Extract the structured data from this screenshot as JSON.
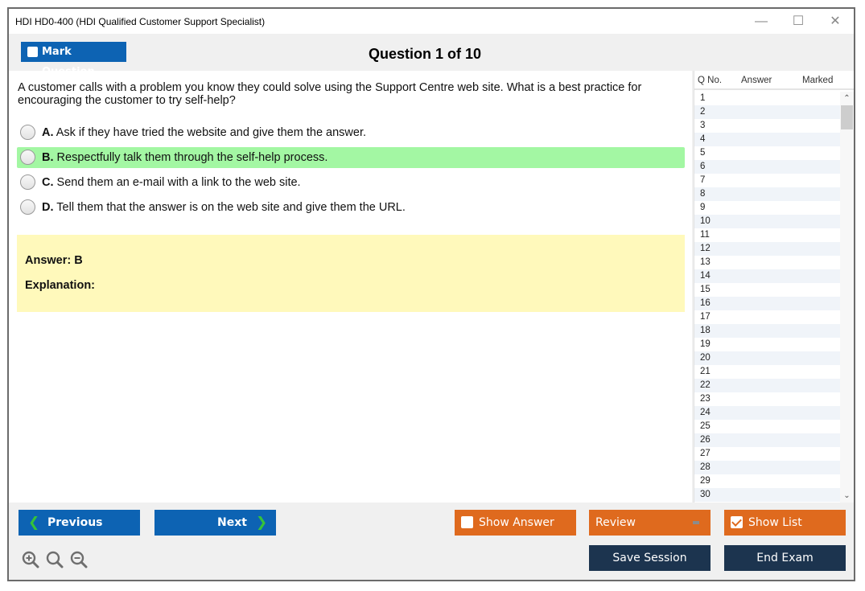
{
  "window": {
    "title": "HDI HD0-400 (HDI Qualified Customer Support Specialist)",
    "controls": {
      "minimize": "—",
      "maximize": "☐",
      "close": "✕"
    }
  },
  "toolbar": {
    "mark_question_label": "Mark Question",
    "question_counter": "Question 1 of 10"
  },
  "question": {
    "text": "A customer calls with a problem you know they could solve using the Support Centre web site. What is a best practice for encouraging the customer to try self-help?",
    "options": [
      {
        "letter": "A.",
        "text": "Ask if they have tried the website and give them the answer.",
        "correct": false
      },
      {
        "letter": "B.",
        "text": "Respectfully talk them through the self-help process.",
        "correct": true
      },
      {
        "letter": "C.",
        "text": "Send them an e-mail with a link to the web site.",
        "correct": false
      },
      {
        "letter": "D.",
        "text": "Tell them that the answer is on the web site and give them the URL.",
        "correct": false
      }
    ],
    "answer_label": "Answer: B",
    "explanation_label": "Explanation:"
  },
  "question_list": {
    "headers": {
      "qno": "Q No.",
      "answer": "Answer",
      "marked": "Marked"
    },
    "rows": [
      "1",
      "2",
      "3",
      "4",
      "5",
      "6",
      "7",
      "8",
      "9",
      "10",
      "11",
      "12",
      "13",
      "14",
      "15",
      "16",
      "17",
      "18",
      "19",
      "20",
      "21",
      "22",
      "23",
      "24",
      "25",
      "26",
      "27",
      "28",
      "29",
      "30"
    ],
    "scroll_up": "^",
    "scroll_down": "v"
  },
  "footer": {
    "previous_label": "Previous",
    "next_label": "Next",
    "show_answer_label": "Show Answer",
    "show_answer_checked": false,
    "review_label": "Review",
    "show_list_label": "Show List",
    "show_list_checked": true,
    "save_session_label": "Save Session",
    "end_exam_label": "End Exam",
    "prev_chevron": "❮",
    "next_chevron": "❯"
  },
  "colors": {
    "primary_blue": "#0d63b3",
    "accent_orange": "#df6a1e",
    "navy": "#1c344f",
    "correct_green": "#a3f7a3",
    "answer_yellow": "#fff9bb",
    "chevron_green": "#36c23a"
  }
}
